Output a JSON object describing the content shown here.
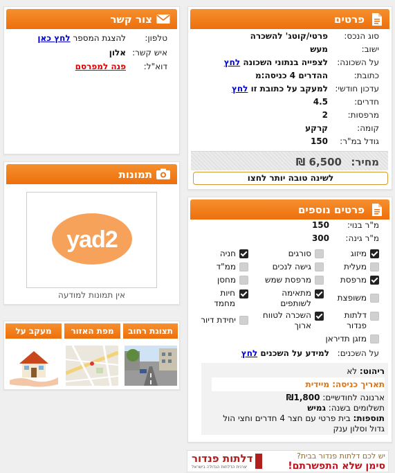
{
  "details": {
    "title": "פרטים",
    "rows": [
      {
        "label": "סוג הנכס:",
        "value": "פרטי/קוטג' להשכרה"
      },
      {
        "label": "ישוב:",
        "value": "מעש"
      },
      {
        "label": "על השכונה:",
        "value": "לצפייה בנתוני השכונה",
        "link": "לחץ"
      },
      {
        "label": "כתובת:",
        "value": "ההדרים 4 כניסה:מ"
      },
      {
        "label": "עדכון חודשי:",
        "value": "למעקב על כתובת זו",
        "link": "לחץ"
      },
      {
        "label": "חדרים:",
        "value": "4.5"
      },
      {
        "label": "מרפסות:",
        "value": "2"
      },
      {
        "label": "קומה:",
        "value": "קרקע"
      },
      {
        "label": "גודל במ\"ר:",
        "value": "150"
      }
    ],
    "price_label": "מחיר:",
    "price_value": "6,500 ₪",
    "better_rate_button": "לשינה טובה יותר לחצו"
  },
  "contact": {
    "title": "צור קשר",
    "phone_label": "טלפון:",
    "phone_text": "להצגת המספר",
    "phone_link": "לחץ כאן",
    "person_label": "איש קשר:",
    "person_value": "אלון",
    "email_label": "דוא\"ל:",
    "email_link": "פנה למפרסם"
  },
  "photos": {
    "title": "תמונות",
    "logo_text": "yad2",
    "no_photos": "אין תמונות למודעה"
  },
  "tabs": [
    {
      "label": "תצוגת רחוב"
    },
    {
      "label": "מפת האזור"
    },
    {
      "label": "מעקב על הנכס"
    }
  ],
  "more": {
    "title": "פרטים נוספים",
    "built_label": "מ\"ר בנוי:",
    "built_value": "150",
    "garden_label": "מ\"ר גינה:",
    "garden_value": "300",
    "features": [
      {
        "label": "מיזוג",
        "checked": true
      },
      {
        "label": "סורגים",
        "checked": false
      },
      {
        "label": "חניה",
        "checked": true
      },
      {
        "label": "מעלית",
        "checked": false
      },
      {
        "label": "גישה לנכים",
        "checked": false
      },
      {
        "label": "ממ\"ד",
        "checked": false
      },
      {
        "label": "מרפסת",
        "checked": true
      },
      {
        "label": "מרפסת שמש",
        "checked": false
      },
      {
        "label": "מחסן",
        "checked": false
      },
      {
        "label": "משופצת",
        "checked": false
      },
      {
        "label": "מתאימה לשותפים",
        "checked": true
      },
      {
        "label": "חיות מחמד",
        "checked": true
      },
      {
        "label": "דלתות פנדור",
        "checked": false
      },
      {
        "label": "השכרה לטווח ארוך",
        "checked": true
      },
      {
        "label": "יחידת דיור",
        "checked": false
      },
      {
        "label": "מזגן תדיראן",
        "checked": false
      }
    ],
    "neighbors_label": "על השכנים:",
    "neighbors_value": "למידע על השכנים",
    "neighbors_link": "לחץ",
    "furniture_label": "ריהוט:",
    "furniture_value": "לא",
    "entry_date": "תאריך כניסה: מיידית",
    "arnona_label": "ארנונה לחודשיים:",
    "arnona_value": "₪1,800",
    "payments_label": "תשלומים בשנה:",
    "payments_value": "גמיש",
    "extras_label": "תוספות:",
    "extras_value": "בית פרטי עם חצר 4 חדרים וחצי הול גדול וסלון ענק"
  },
  "ad": {
    "line1": "יש לכם דלתות פנדור בבית?",
    "line2": "סימן שלא התפשרתם!",
    "brand": "דלתות פנדור",
    "brand_sub": "יצרנית הדלתות הגדולה בישראל"
  },
  "colors": {
    "accent": "#ed6f0d",
    "link": "#0000cc",
    "red": "#d00000"
  }
}
